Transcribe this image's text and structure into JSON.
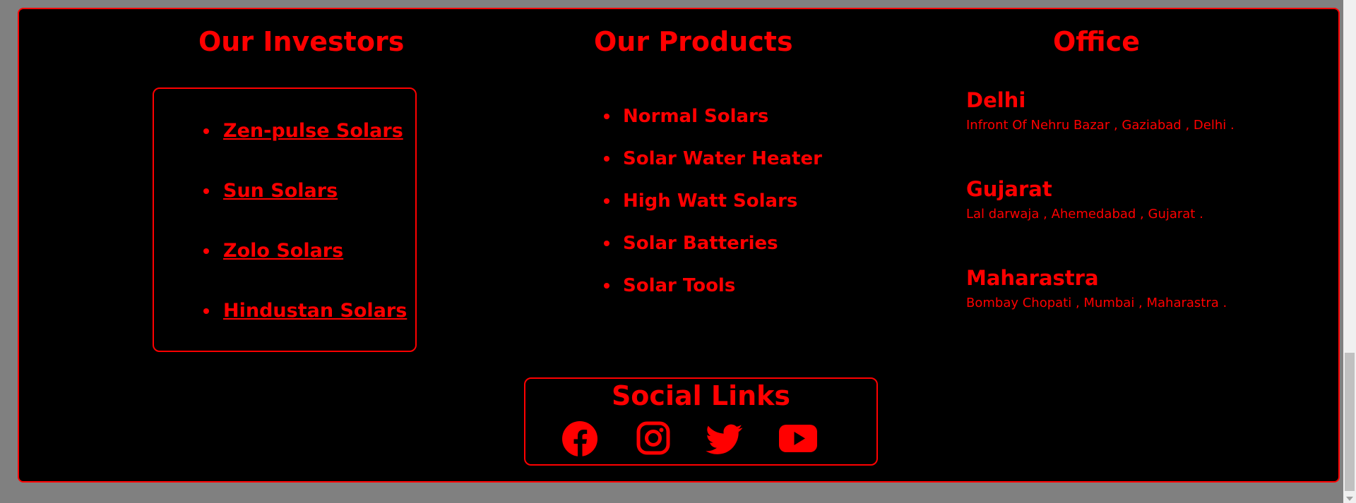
{
  "colors": {
    "accent": "#ff0000",
    "background": "#000000",
    "page_background": "#808080"
  },
  "investors": {
    "title": "Our Investors",
    "items": [
      {
        "label": "Zen-pulse Solars"
      },
      {
        "label": "Sun Solars"
      },
      {
        "label": "Zolo Solars"
      },
      {
        "label": "Hindustan Solars"
      }
    ]
  },
  "products": {
    "title": "Our Products",
    "items": [
      {
        "label": "Normal Solars"
      },
      {
        "label": "Solar Water Heater"
      },
      {
        "label": "High Watt Solars"
      },
      {
        "label": "Solar Batteries"
      },
      {
        "label": "Solar Tools"
      }
    ]
  },
  "office": {
    "title": "Office",
    "locations": [
      {
        "city": "Delhi",
        "address": "Infront Of Nehru Bazar , Gaziabad , Delhi ."
      },
      {
        "city": "Gujarat",
        "address": "Lal darwaja , Ahemedabad , Gujarat ."
      },
      {
        "city": "Maharastra",
        "address": "Bombay Chopati , Mumbai , Maharastra ."
      }
    ]
  },
  "social": {
    "title": "Social Links",
    "icons": [
      "facebook-icon",
      "instagram-icon",
      "twitter-icon",
      "youtube-icon"
    ]
  }
}
